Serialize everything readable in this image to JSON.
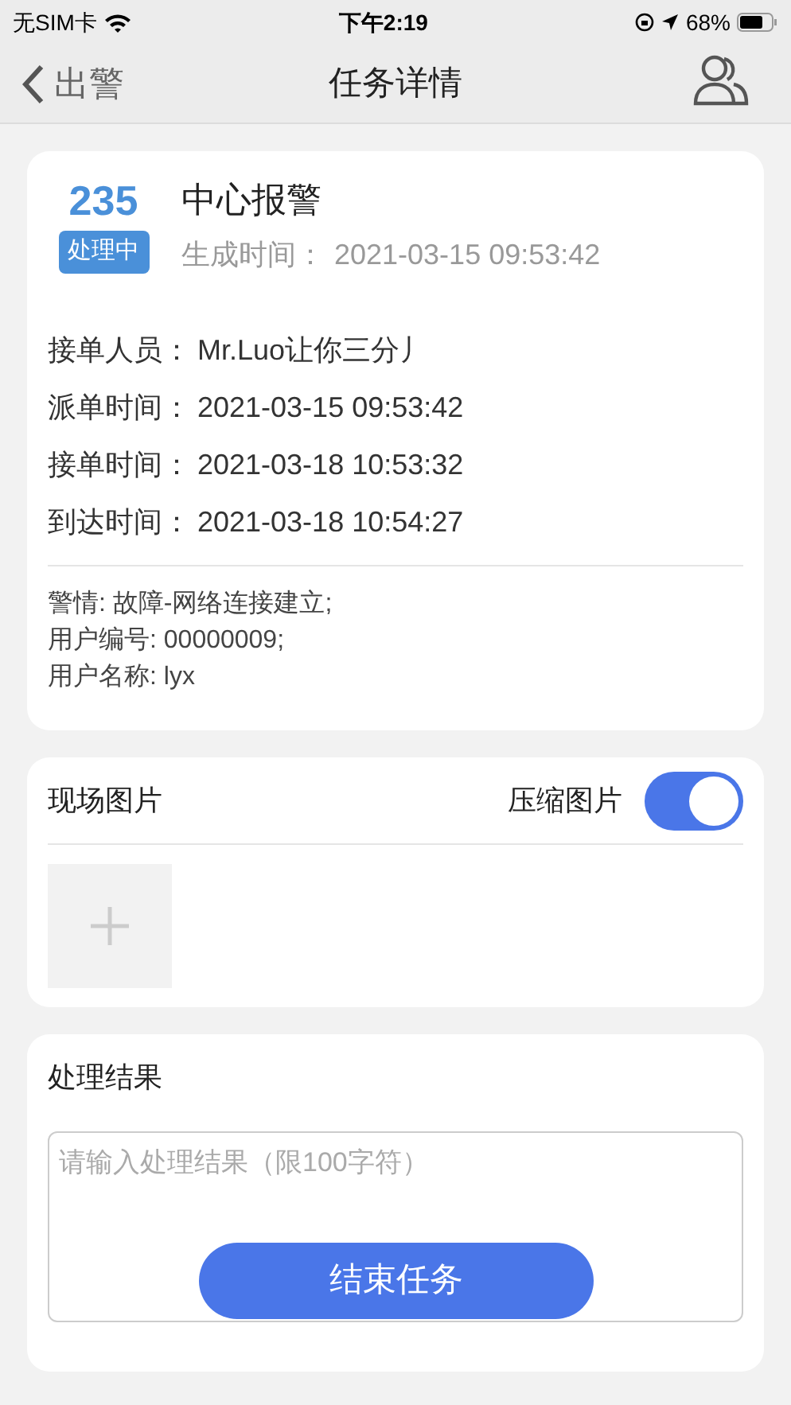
{
  "status_bar": {
    "carrier": "无SIM卡",
    "time": "下午2:19",
    "battery": "68%"
  },
  "nav": {
    "back": "出警",
    "title": "任务详情"
  },
  "task": {
    "number": "235",
    "type": "中心报警",
    "status": "处理中",
    "created_label": "生成时间：",
    "created": "2021-03-15 09:53:42",
    "fields": [
      {
        "label": "接单人员：",
        "value": "Mr.Luo让你三分丿"
      },
      {
        "label": "派单时间：",
        "value": "2021-03-15 09:53:42"
      },
      {
        "label": "接单时间：",
        "value": "2021-03-18 10:53:32"
      },
      {
        "label": "到达时间：",
        "value": "2021-03-18 10:54:27"
      }
    ],
    "info": [
      "警情: 故障-网络连接建立;",
      "用户编号: 00000009;",
      "用户名称: lyx"
    ]
  },
  "photos": {
    "title": "现场图片",
    "compress_label": "压缩图片",
    "compress_on": true
  },
  "result": {
    "title": "处理结果",
    "placeholder": "请输入处理结果（限100字符）",
    "button": "结束任务"
  }
}
